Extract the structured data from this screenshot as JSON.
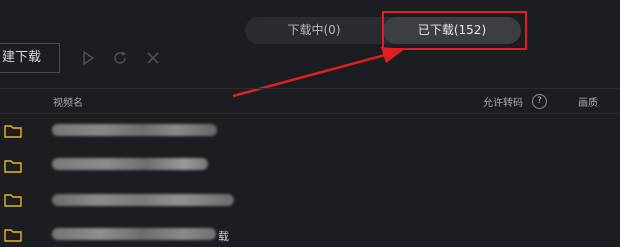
{
  "tabs": {
    "downloading_label": "下载中(0)",
    "downloaded_label": "已下载(152)"
  },
  "toolbar": {
    "new_download_label": "建下载",
    "icons": [
      "play-icon",
      "refresh-icon",
      "close-icon"
    ]
  },
  "table": {
    "headers": {
      "name": "视频名",
      "transcode": "允许转码",
      "help": "?",
      "quality": "画质"
    },
    "rows": [
      {
        "name": "",
        "icon": "folder-icon"
      },
      {
        "name": "",
        "icon": "folder-icon"
      },
      {
        "name": "",
        "icon": "folder-icon"
      },
      {
        "name": "载",
        "icon": "folder-icon"
      }
    ]
  },
  "colors": {
    "background": "#1c1d20",
    "highlight": "#e02020",
    "folder": "#e6b422"
  }
}
